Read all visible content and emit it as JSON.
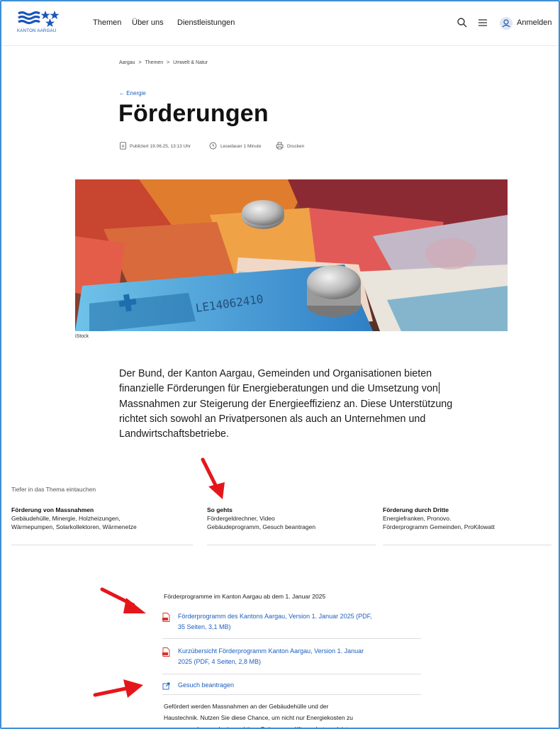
{
  "header": {
    "logo_text": "KANTON AARGAU",
    "nav": [
      {
        "label": "Themen"
      },
      {
        "label": "Über uns"
      },
      {
        "label": "Dienstleistungen"
      }
    ],
    "login_label": "Anmelden",
    "icons": [
      "search-icon",
      "menu-icon",
      "user-icon"
    ]
  },
  "breadcrumb": [
    "Aargau",
    "Themen",
    "Umwelt & Natur"
  ],
  "breadcrumb_sep": ">",
  "back_link": "← Energie",
  "title": "Förderungen",
  "meta": {
    "published": "Publiziert 19.06.25, 13:13 Uhr",
    "reading": "Lesedauer 1 Minute",
    "print": "Drucken"
  },
  "image_credit": "iStock",
  "lead": "Der Bund, der Kanton Aargau, Gemeinden und Organisationen bieten finanzielle Förderungen für Energieberatungen und die Umsetzung von Massnahmen zur Steigerung der Energieeffizienz an. Diese Unterstützung richtet sich sowohl an Privatpersonen als auch an Unternehmen und Landwirtschaftsbetriebe.",
  "lead_lines": [
    "Der Bund, der Kanton Aargau, Gemeinden und Organisationen bieten",
    "finanzielle Förderungen für Energieberatungen und die Umsetzung von",
    "Massnahmen zur Steigerung der Energieeffizienz an. Diese Unterstützung",
    "richtet sich sowohl an Privatpersonen als auch an Unternehmen und",
    "Landwirtschaftsbetriebe."
  ],
  "deeper": {
    "title": "Tiefer in das Thema eintauchen",
    "columns": [
      {
        "title": "Förderung von Massnahmen",
        "lines": [
          "Gebäudehülle, Minergie, Holzheizungen,",
          "Wärmepumpen, Solarkollektoren, Wärmenetze"
        ]
      },
      {
        "title": "So gehts",
        "lines": [
          "Fördergeldrechner, Video",
          "Gebäudeprogramm, Gesuch beantragen"
        ]
      },
      {
        "title": "Förderung durch Dritte",
        "lines": [
          "Energiefranken, Pronovo.",
          "Förderprogramm Gemeinden, ProKilowatt"
        ]
      }
    ]
  },
  "downloads": {
    "intro": "Förderprogramme im Kanton Aargau ab dem 1. Januar 2025",
    "items": [
      {
        "lines": [
          "Förderprogramm des Kantons Aargau, Version 1. Januar 2025 (PDF,",
          "35 Seiten, 3,1 MB)"
        ],
        "icon": "pdf-icon"
      },
      {
        "lines": [
          "Kurzübersicht Förderprogramm Kanton Aargau, Version 1. Januar",
          "2025 (PDF, 4 Seiten, 2,8 MB)"
        ],
        "icon": "pdf-icon"
      },
      {
        "lines": [
          "Gesuch beantragen"
        ],
        "icon": "external-link-icon"
      }
    ]
  },
  "body_text": [
    "Gefördert werden Massnahmen an der Gebäudehülle und der",
    "Haustechnik. Nutzen Sie diese Chance, um nicht nur Energiekosten zu",
    "sparen, sondern auch einen aktiven Beitrag zum Klimaschutz zu leisten."
  ],
  "colors": {
    "accent": "#1c5fbf",
    "frame_border": "#3d8fd6",
    "annotation_arrow": "#e5161b",
    "pdf_red": "#d9302a"
  }
}
